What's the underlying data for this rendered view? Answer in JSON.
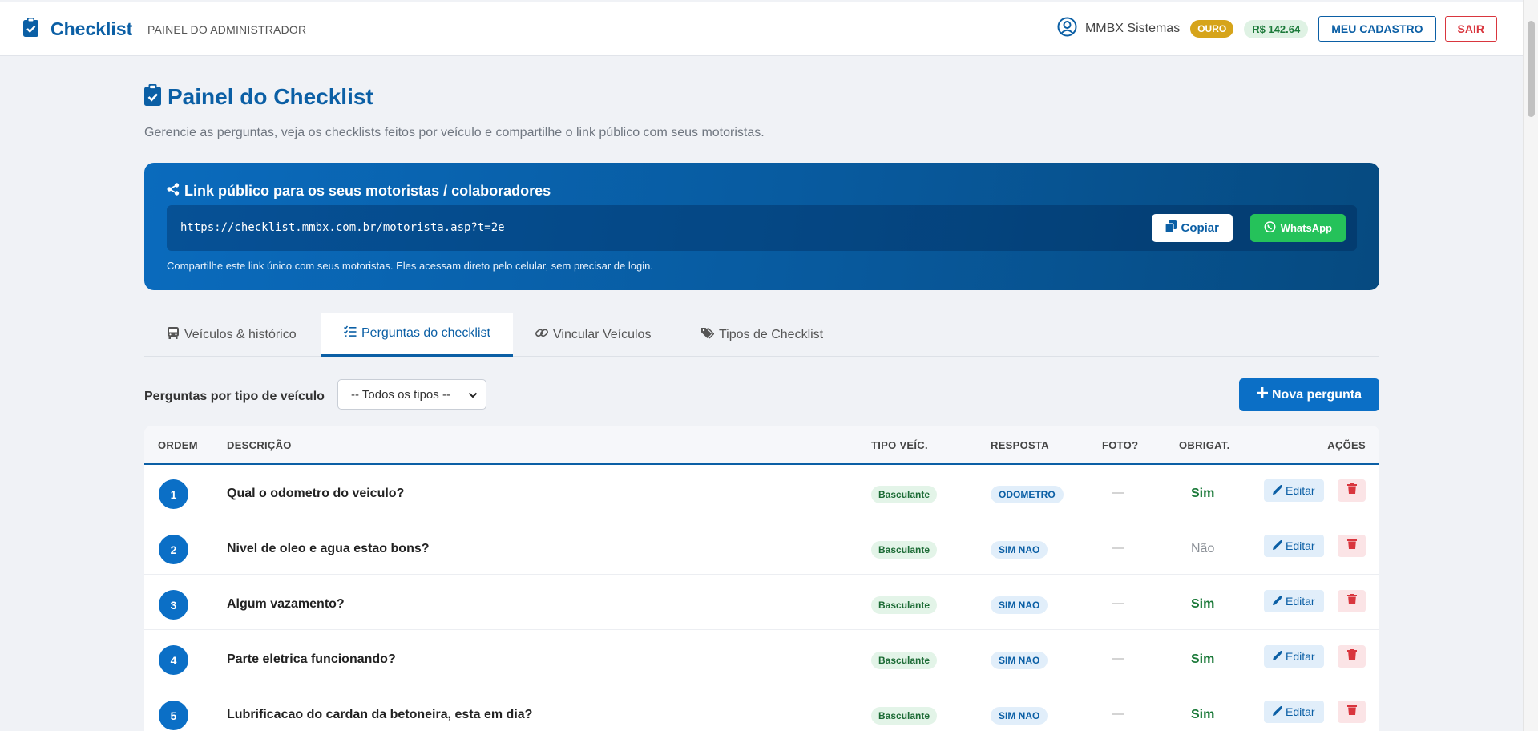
{
  "header": {
    "brand": "Checklist",
    "subtitle": "PAINEL DO ADMINISTRADOR",
    "user_name": "MMBX Sistemas",
    "plan_badge": "OURO",
    "balance": "R$ 142.64",
    "profile_button": "MEU CADASTRO",
    "logout_button": "SAIR"
  },
  "page": {
    "title": "Painel do Checklist",
    "subtitle": "Gerencie as perguntas, veja os checklists feitos por veículo e compartilhe o link público com seus motoristas."
  },
  "link_card": {
    "title": "Link público para os seus motoristas / colaboradores",
    "url": "https://checklist.mmbx.com.br/motorista.asp?t=2e",
    "copy_label": "Copiar",
    "whatsapp_label": "WhatsApp",
    "help_text": "Compartilhe este link único com seus motoristas. Eles acessam direto pelo celular, sem precisar de login."
  },
  "tabs": [
    {
      "label": "Veículos & histórico",
      "icon": "bus-icon"
    },
    {
      "label": "Perguntas do checklist",
      "icon": "list-check-icon",
      "active": true
    },
    {
      "label": "Vincular Veículos",
      "icon": "link-icon"
    },
    {
      "label": "Tipos de Checklist",
      "icon": "tags-icon"
    }
  ],
  "filter": {
    "label": "Perguntas por tipo de veículo",
    "selected": "-- Todos os tipos --",
    "new_button": "Nova pergunta"
  },
  "table": {
    "columns": [
      "ORDEM",
      "DESCRIÇÃO",
      "TIPO VEÍC.",
      "RESPOSTA",
      "FOTO?",
      "OBRIGAT.",
      "AÇÕES"
    ],
    "edit_label": "Editar",
    "rows": [
      {
        "order": "1",
        "description": "Qual o odometro do veiculo?",
        "vehicle_type": "Basculante",
        "answer": "ODOMETRO",
        "photo": "—",
        "required": "Sim"
      },
      {
        "order": "2",
        "description": "Nivel de oleo e agua estao bons?",
        "vehicle_type": "Basculante",
        "answer": "SIM NAO",
        "photo": "—",
        "required": "Não"
      },
      {
        "order": "3",
        "description": "Algum vazamento?",
        "vehicle_type": "Basculante",
        "answer": "SIM NAO",
        "photo": "—",
        "required": "Sim"
      },
      {
        "order": "4",
        "description": "Parte eletrica funcionando?",
        "vehicle_type": "Basculante",
        "answer": "SIM NAO",
        "photo": "—",
        "required": "Sim"
      },
      {
        "order": "5",
        "description": "Lubrificacao do cardan da betoneira, esta em dia?",
        "vehicle_type": "Basculante",
        "answer": "SIM NAO",
        "photo": "—",
        "required": "Sim"
      }
    ]
  },
  "colors": {
    "primary": "#0b5fa5",
    "accent": "#0b6fc6",
    "success": "#25c25a",
    "danger": "#d9363e",
    "gold": "#d6a41a"
  }
}
